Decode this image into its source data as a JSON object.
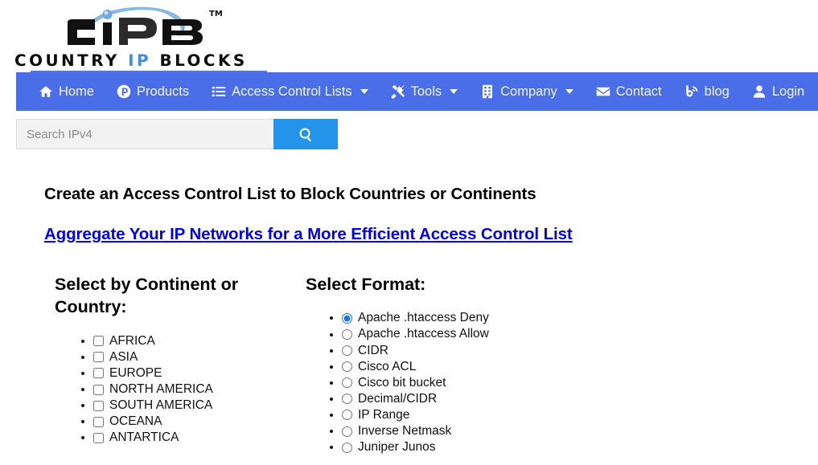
{
  "brand": {
    "logo_mark_text": "CIPB",
    "trademark": "TM",
    "wordmark_pre": "COUNTRY ",
    "wordmark_ip": "IP",
    "wordmark_post": " BLOCKS",
    "accent_blue": "#3c8ee0",
    "nav_blue": "#4a6ee8",
    "button_blue": "#2494eb"
  },
  "nav": {
    "items": [
      {
        "label": "Home",
        "icon": "home-icon",
        "caret": false
      },
      {
        "label": "Products",
        "icon": "product-hunt-icon",
        "caret": false
      },
      {
        "label": "Access Control Lists",
        "icon": "list-icon",
        "caret": true
      },
      {
        "label": "Tools",
        "icon": "tools-icon",
        "caret": true
      },
      {
        "label": "Company",
        "icon": "building-icon",
        "caret": true
      },
      {
        "label": "Contact",
        "icon": "envelope-icon",
        "caret": false
      },
      {
        "label": "blog",
        "icon": "blogger-rss-icon",
        "caret": false
      },
      {
        "label": "Login",
        "icon": "user-icon",
        "caret": false
      }
    ]
  },
  "search": {
    "placeholder": "Search IPv4",
    "value": "",
    "button_icon": "search-icon"
  },
  "main": {
    "title": "Create an Access Control List to Block Countries or Continents",
    "aggregate_link": "Aggregate Your IP Networks for a More Efficient Access Control List",
    "continent": {
      "heading": "Select by Continent or Country:",
      "items": [
        {
          "label": "AFRICA",
          "checked": false
        },
        {
          "label": "ASIA",
          "checked": false
        },
        {
          "label": "EUROPE",
          "checked": false
        },
        {
          "label": "NORTH AMERICA",
          "checked": false
        },
        {
          "label": "SOUTH AMERICA",
          "checked": false
        },
        {
          "label": "OCEANA",
          "checked": false
        },
        {
          "label": "ANTARTICA",
          "checked": false
        }
      ]
    },
    "format": {
      "heading": "Select Format:",
      "items": [
        {
          "label": "Apache .htaccess Deny",
          "selected": true
        },
        {
          "label": "Apache .htaccess Allow",
          "selected": false
        },
        {
          "label": "CIDR",
          "selected": false
        },
        {
          "label": "Cisco ACL",
          "selected": false
        },
        {
          "label": "Cisco bit bucket",
          "selected": false
        },
        {
          "label": "Decimal/CIDR",
          "selected": false
        },
        {
          "label": "IP Range",
          "selected": false
        },
        {
          "label": "Inverse Netmask",
          "selected": false
        },
        {
          "label": "Juniper Junos",
          "selected": false
        }
      ]
    }
  }
}
